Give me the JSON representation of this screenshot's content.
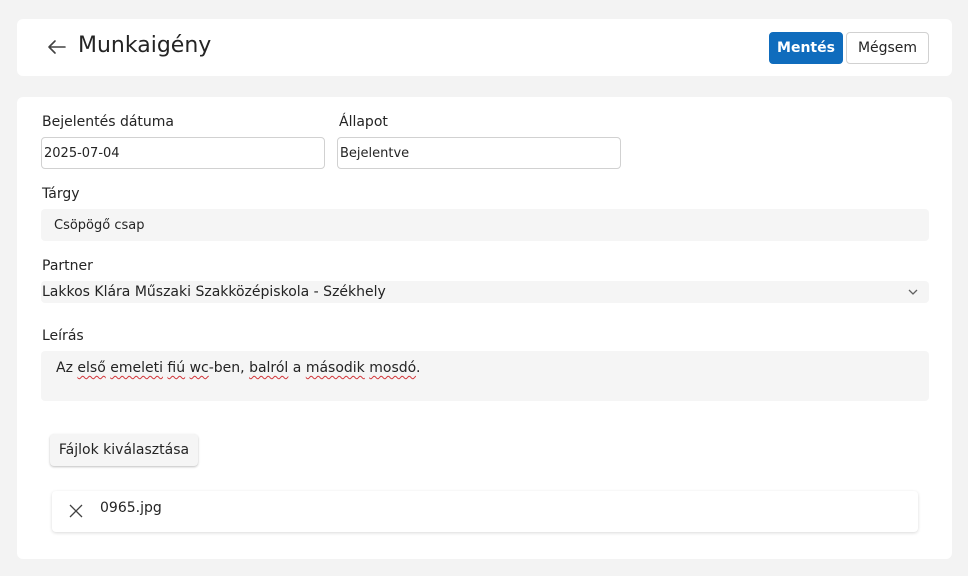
{
  "header": {
    "title": "Munkaigény",
    "save_label": "Mentés",
    "cancel_label": "Mégsem",
    "back_icon": "arrow-left-icon"
  },
  "form": {
    "date": {
      "label": "Bejelentés dátuma",
      "value": "2025-07-04"
    },
    "status": {
      "label": "Állapot",
      "value": "Bejelentve"
    },
    "subject": {
      "label": "Tárgy",
      "value": "Csöpögő csap"
    },
    "partner": {
      "label": "Partner",
      "value": "Lakkos Klára Műszaki Szakközépiskola - Székhely"
    },
    "description": {
      "label": "Leírás",
      "parts": [
        "Az ",
        "első",
        " ",
        "emeleti",
        " ",
        "fiú",
        " ",
        "wc",
        "-ben, ",
        "balról",
        " a ",
        "második",
        " ",
        "mosdó",
        "."
      ]
    }
  },
  "files": {
    "select_label": "Fájlok kiválasztása",
    "items": [
      {
        "name": "0965.jpg"
      }
    ]
  },
  "colors": {
    "accent": "#0f6cbd",
    "background": "#f3f3f3",
    "field_fill": "#f5f5f5",
    "spellcheck": "#d13438"
  }
}
